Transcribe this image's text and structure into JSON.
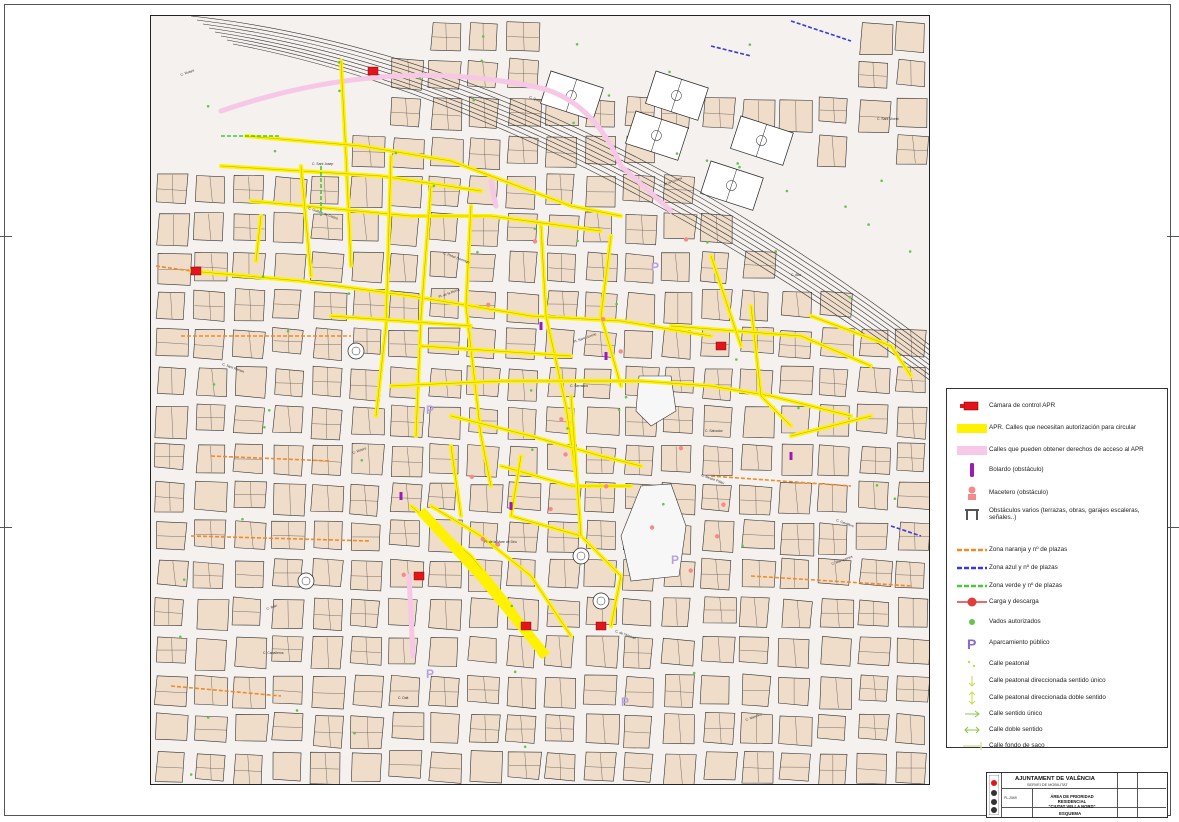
{
  "map": {
    "street_labels": [
      "C. Ruaya",
      "C. Sant Josep",
      "C. Pintor Domingo",
      "Pl. Sant Llorenç",
      "C. Salvador",
      "C. Cavallers",
      "C. Baix",
      "C. Dalt",
      "C. Quart",
      "C. de la Corona",
      "C. Alta",
      "C. Sant Ramon",
      "C. Roters",
      "Pl. de la Mare de Déu",
      "C. de l'Almirall",
      "C. Navellos",
      "C. Sant Vicent",
      "C. Guillem de Castro",
      "Pl. de la Reina",
      "C. Serranos",
      "C. Mestre Palau",
      "C. Blanqueries",
      "C. Caballeros"
    ],
    "park_markers": [
      "P",
      "P",
      "P",
      "P",
      "P"
    ]
  },
  "legend": {
    "items": [
      {
        "id": "camara",
        "label": "Cámara de control APR",
        "color": "#e3151a"
      },
      {
        "id": "apr",
        "label": "APR. Calles que necesitan autorización para circular",
        "color": "#fff200"
      },
      {
        "id": "derechos",
        "label": "Calles que pueden obtener derechos de acceso al APR",
        "color": "#f8c8e8"
      },
      {
        "id": "bolardo",
        "label": "Bolardo (obstáculo)",
        "color": "#9b1bb8"
      },
      {
        "id": "macetero",
        "label": "Macetero (obstáculo)",
        "color": "#f48a8a"
      },
      {
        "id": "obstaculos",
        "label": "Obstáculos varios (terrazas, obras, garajes escaleras, señales..)",
        "color": "#555555"
      },
      {
        "id": "naranja",
        "label": "Zona naranja y nº de plazas",
        "color": "#f08a2a"
      },
      {
        "id": "azul",
        "label": "Zona azul y nº de plazas",
        "color": "#3a3ad8"
      },
      {
        "id": "verde",
        "label": "Zona verde y nº de plazas",
        "color": "#48c83a"
      },
      {
        "id": "carga",
        "label": "Carga y descarga",
        "color": "#e33a3a"
      },
      {
        "id": "vados",
        "label": "Vados autorizados",
        "color": "#66c44a"
      },
      {
        "id": "aparcamiento",
        "label": "Aparcamiento público",
        "color": "#8a6ac8"
      },
      {
        "id": "peatonal",
        "label": "Calle peatonal",
        "color": "#c8d84a"
      },
      {
        "id": "peatonal_unico",
        "label": "Calle peatonal direccionada sentido único",
        "color": "#c8d84a"
      },
      {
        "id": "peatonal_doble",
        "label": "Calle peatonal direccionada doble sentido",
        "color": "#c8d84a"
      },
      {
        "id": "sentido_unico",
        "label": "Calle sentido único",
        "color": "#88c84a"
      },
      {
        "id": "doble_sentido",
        "label": "Calle doble sentido",
        "color": "#88c84a"
      },
      {
        "id": "fondo_saco",
        "label": "Calle fondo de saco",
        "color": "#d8e0a0"
      }
    ]
  },
  "title_block": {
    "organization": "AJUNTAMENT DE VALÈNCIA",
    "department": "SERVEI DE MOBILITAT",
    "plan_code": "PL-2569",
    "title_line1": "ÁREA DE PRIORIDAD RESIDENCIAL",
    "title_line2": "\"CIUTAT VELLA NORD\"",
    "subtitle": "ESQUEMA"
  }
}
